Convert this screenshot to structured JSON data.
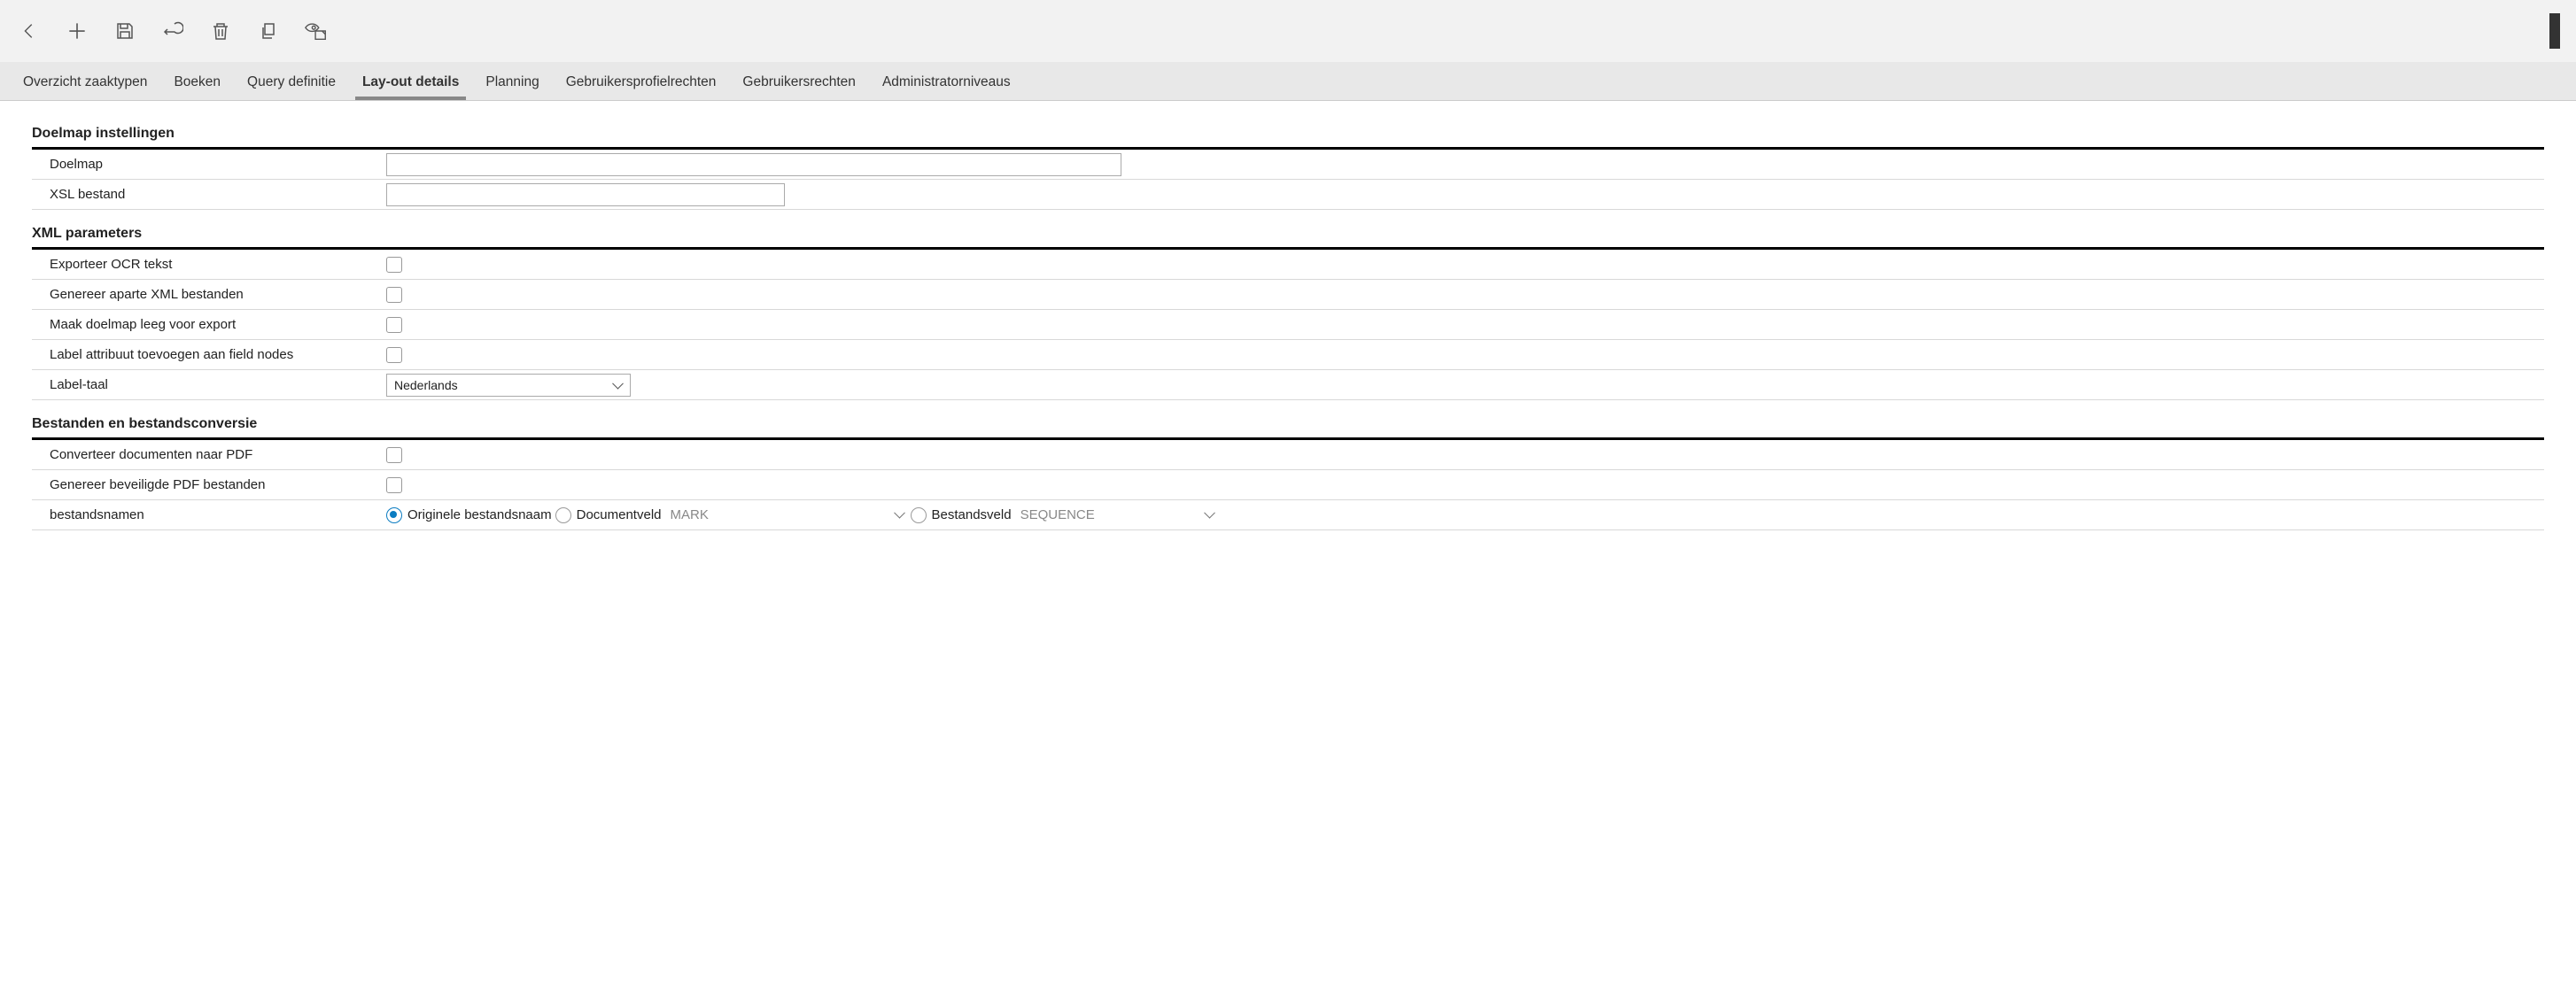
{
  "tabs": [
    "Overzicht zaaktypen",
    "Boeken",
    "Query definitie",
    "Lay-out details",
    "Planning",
    "Gebruikersprofielrechten",
    "Gebruikersrechten",
    "Administratorniveaus"
  ],
  "active_tab_index": 3,
  "sections": {
    "doelmap": {
      "title": "Doelmap instellingen",
      "doelmap_label": "Doelmap",
      "doelmap_value": "",
      "xsl_label": "XSL bestand",
      "xsl_value": ""
    },
    "xml": {
      "title": "XML parameters",
      "export_ocr_label": "Exporteer OCR tekst",
      "export_ocr_checked": false,
      "generate_separate_label": "Genereer aparte XML bestanden",
      "generate_separate_checked": false,
      "clear_target_label": "Maak doelmap leeg voor export",
      "clear_target_checked": false,
      "label_attr_label": "Label attribuut toevoegen aan field nodes",
      "label_attr_checked": false,
      "label_lang_label": "Label-taal",
      "label_lang_value": "Nederlands"
    },
    "files": {
      "title": "Bestanden en bestandsconversie",
      "convert_pdf_label": "Converteer documenten naar PDF",
      "convert_pdf_checked": false,
      "secure_pdf_label": "Genereer beveiligde PDF bestanden",
      "secure_pdf_checked": false,
      "filenames_label": "bestandsnamen",
      "radio_original_label": "Originele bestandsnaam",
      "radio_docfield_label": "Documentveld",
      "radio_docfield_value": "MARK",
      "radio_filefield_label": "Bestandsveld",
      "radio_filefield_value": "SEQUENCE"
    }
  }
}
